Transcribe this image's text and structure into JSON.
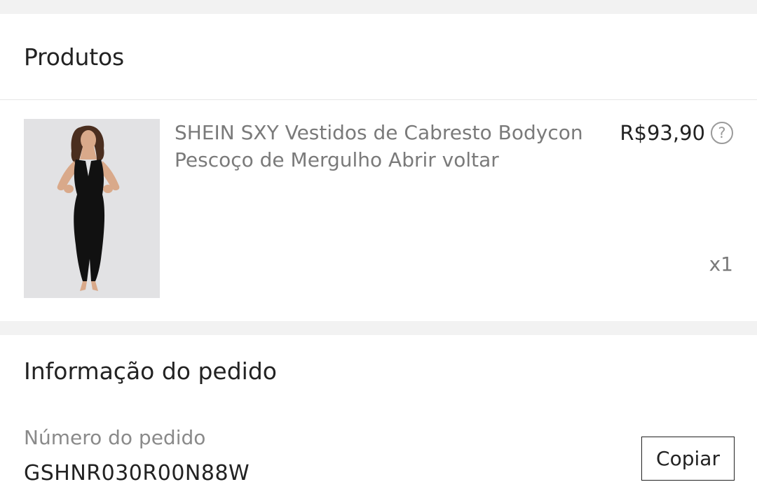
{
  "products_section": {
    "title": "Produtos"
  },
  "product": {
    "name": "SHEIN SXY Vestidos de Cabresto Bodycon Pescoço de Mergulho Abrir voltar",
    "price": "R$93,90",
    "quantity": "x1",
    "image": "product-photo-black-halter-bodycon-dress"
  },
  "order_info": {
    "title": "Informação do pedido",
    "order_number_label": "Número do pedido",
    "order_number": "GSHNR030R00N88W",
    "copy_label": "Copiar"
  },
  "colors": {
    "text_primary": "#222222",
    "text_secondary": "#7a7a7a",
    "background": "#f2f2f2"
  }
}
